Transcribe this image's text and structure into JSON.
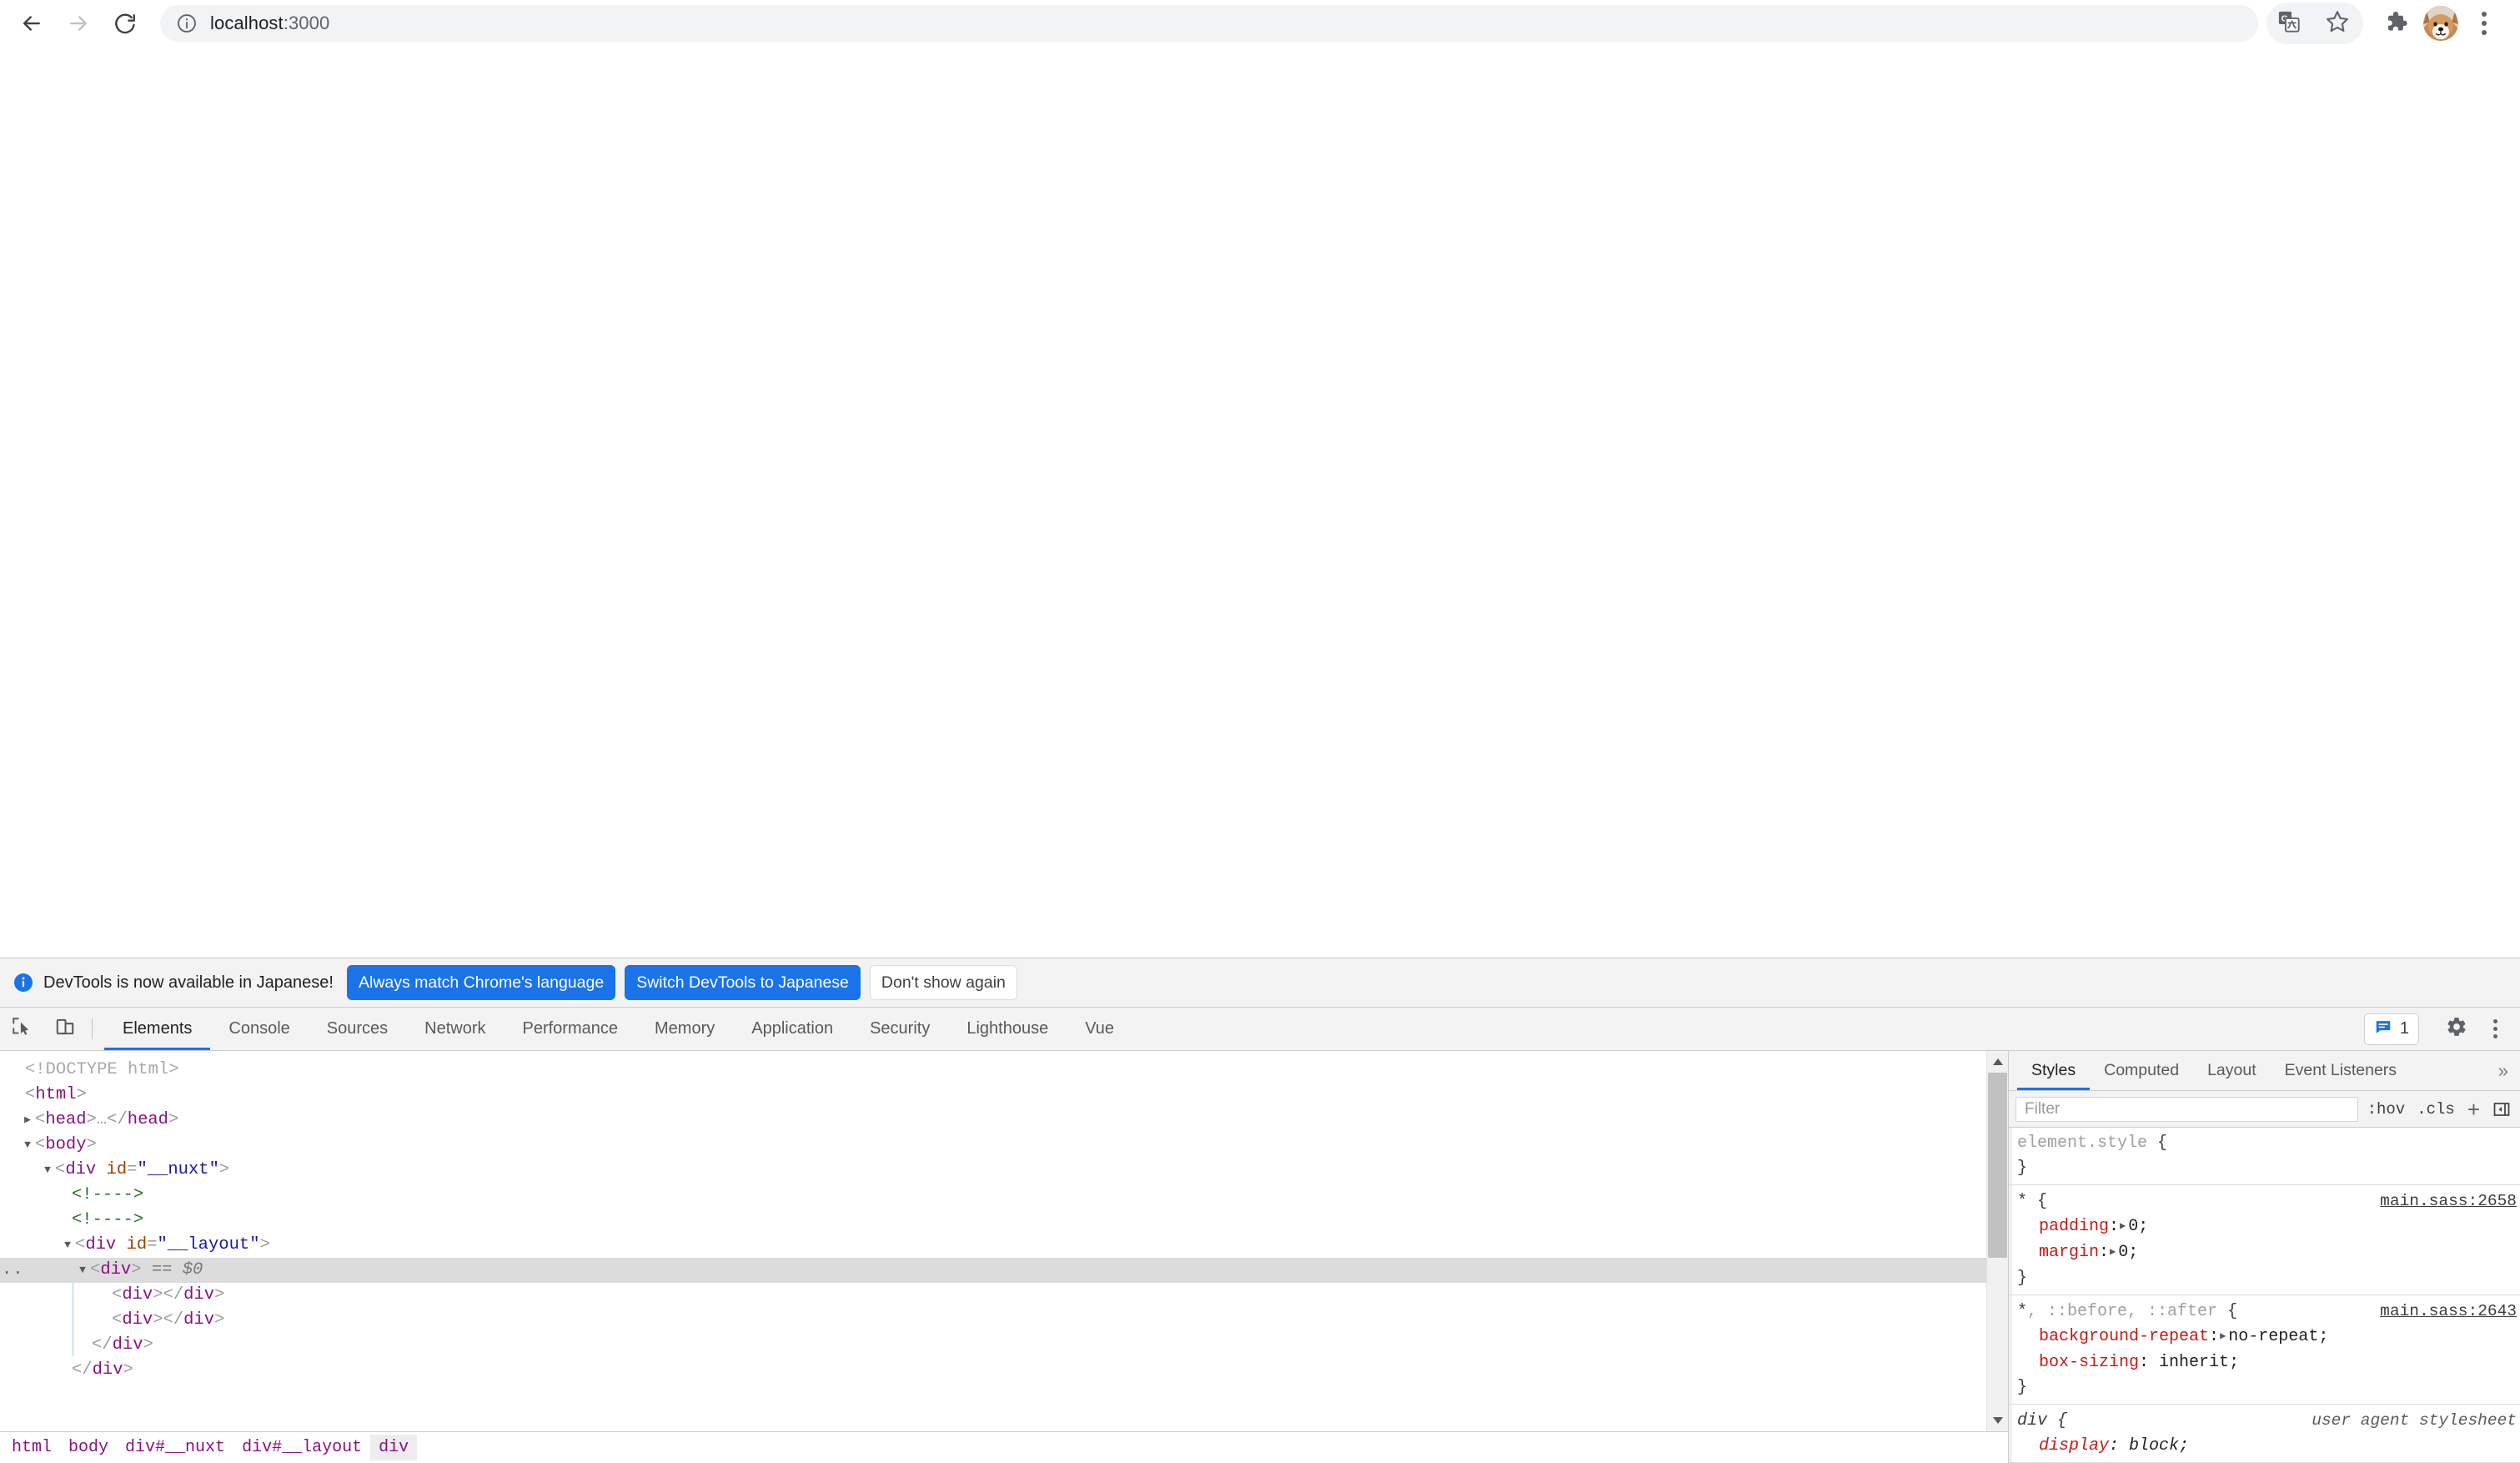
{
  "browser": {
    "back_icon": "arrow-left-icon",
    "forward_icon": "arrow-right-icon",
    "reload_icon": "reload-icon",
    "site_info_icon": "info-circle-icon",
    "url_host": "localhost",
    "url_port": ":3000",
    "url_full": "localhost:3000",
    "translate_icon": "translate-icon",
    "bookmark_icon": "star-outline-icon",
    "extensions_icon": "puzzle-piece-icon",
    "profile_avatar": "dog-avatar",
    "menu_icon": "three-dot-menu-icon"
  },
  "devtools": {
    "notice": {
      "info_icon": "info-circle-icon",
      "message": "DevTools is now available in Japanese!",
      "buttons": [
        {
          "label": "Always match Chrome's language",
          "style": "primary"
        },
        {
          "label": "Switch DevTools to Japanese",
          "style": "primary"
        },
        {
          "label": "Don't show again",
          "style": "secondary"
        }
      ]
    },
    "toolbar": {
      "inspect_icon": "inspect-element-icon",
      "device_icon": "device-toolbar-icon",
      "issues_icon": "issues-message-icon",
      "issues_count": "1",
      "settings_icon": "gear-icon",
      "menu_icon": "three-dot-menu-icon"
    },
    "tabs": [
      {
        "label": "Elements",
        "active": true
      },
      {
        "label": "Console",
        "active": false
      },
      {
        "label": "Sources",
        "active": false
      },
      {
        "label": "Network",
        "active": false
      },
      {
        "label": "Performance",
        "active": false
      },
      {
        "label": "Memory",
        "active": false
      },
      {
        "label": "Application",
        "active": false
      },
      {
        "label": "Security",
        "active": false
      },
      {
        "label": "Lighthouse",
        "active": false
      },
      {
        "label": "Vue",
        "active": false
      }
    ],
    "dom_tree": [
      {
        "indent": 0,
        "twisty": "none",
        "type": "doctype",
        "text": "<!DOCTYPE html>"
      },
      {
        "indent": 0,
        "twisty": "none",
        "type": "tag",
        "tag": "html",
        "text": "<html>"
      },
      {
        "indent": 1,
        "twisty": "collapsed",
        "type": "tag",
        "tag": "head",
        "text": "<head>…</head>"
      },
      {
        "indent": 1,
        "twisty": "expanded",
        "type": "tag",
        "tag": "body",
        "text": "<body>"
      },
      {
        "indent": 2,
        "twisty": "expanded",
        "type": "element",
        "tag": "div",
        "attr_name": "id",
        "attr_value": "__nuxt"
      },
      {
        "indent": 3,
        "twisty": "none",
        "type": "comment",
        "text": "<!---->"
      },
      {
        "indent": 3,
        "twisty": "none",
        "type": "comment",
        "text": "<!---->"
      },
      {
        "indent": 3,
        "twisty": "expanded",
        "type": "element",
        "tag": "div",
        "attr_name": "id",
        "attr_value": "__layout"
      },
      {
        "indent": 4,
        "twisty": "expanded",
        "type": "selected",
        "tag": "div",
        "ref": "== $0",
        "gutter": "..",
        "selected": true
      },
      {
        "indent": 5,
        "twisty": "none",
        "type": "pair",
        "text": "<div></div>"
      },
      {
        "indent": 5,
        "twisty": "none",
        "type": "pair",
        "text": "<div></div>"
      },
      {
        "indent": 4,
        "twisty": "none",
        "type": "close",
        "text": "</div>"
      },
      {
        "indent": 3,
        "twisty": "none",
        "type": "close",
        "text": "</div>"
      }
    ],
    "breadcrumb": [
      {
        "label": "html",
        "active": false
      },
      {
        "label": "body",
        "active": false
      },
      {
        "label": "div#__nuxt",
        "active": false
      },
      {
        "label": "div#__layout",
        "active": false
      },
      {
        "label": "div",
        "active": true
      }
    ],
    "styles": {
      "tabs": [
        {
          "label": "Styles",
          "active": true
        },
        {
          "label": "Computed",
          "active": false
        },
        {
          "label": "Layout",
          "active": false
        },
        {
          "label": "Event Listeners",
          "active": false
        }
      ],
      "overflow_label": "»",
      "filter_placeholder": "Filter",
      "filter_value": "",
      "hov_label": ":hov",
      "cls_label": ".cls",
      "new_rule_label": "+",
      "sidebar_toggle_icon": "panel-collapse-icon",
      "rules": [
        {
          "selector": "element.style",
          "selector_suffix": "",
          "source": "",
          "source_type": "none",
          "declarations": []
        },
        {
          "selector": "*",
          "selector_suffix": "",
          "source": "main.sass:2658",
          "source_type": "link",
          "declarations": [
            {
              "property": "padding",
              "value": "0",
              "expandable": true
            },
            {
              "property": "margin",
              "value": "0",
              "expandable": true
            }
          ]
        },
        {
          "selector": "*",
          "selector_suffix": ", ::before, ::after",
          "source": "main.sass:2643",
          "source_type": "link",
          "declarations": [
            {
              "property": "background-repeat",
              "value": "no-repeat",
              "expandable": true
            },
            {
              "property": "box-sizing",
              "value": "inherit",
              "expandable": false
            }
          ]
        },
        {
          "selector": "div",
          "selector_suffix": "",
          "source": "user agent stylesheet",
          "source_type": "ua",
          "italic": true,
          "declarations": [
            {
              "property": "display",
              "value": "block",
              "expandable": false,
              "italic": true
            }
          ]
        }
      ]
    }
  },
  "colors": {
    "accent_blue": "#1a73e8",
    "tag_purple": "#881280",
    "attr_orange": "#994500",
    "attr_value_blue": "#1a1aa6",
    "comment_green": "#236e25",
    "css_property_red": "#c41a16",
    "toolbar_grey": "#f3f3f3",
    "selected_row_grey": "#dcdcdc"
  }
}
